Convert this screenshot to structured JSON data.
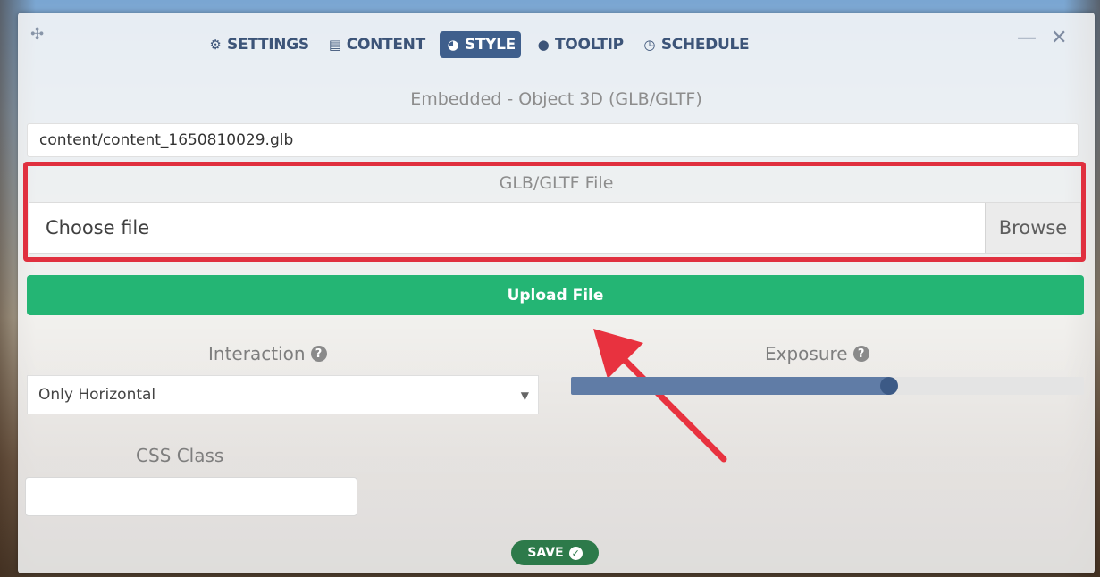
{
  "tabs": [
    {
      "label": "SETTINGS",
      "icon": "gear-icon",
      "glyph": "⚙",
      "active": false
    },
    {
      "label": "CONTENT",
      "icon": "content-icon",
      "glyph": "▤",
      "active": false
    },
    {
      "label": "STYLE",
      "icon": "palette-icon",
      "glyph": "◕",
      "active": true
    },
    {
      "label": "TOOLTIP",
      "icon": "chat-icon",
      "glyph": "●",
      "active": false
    },
    {
      "label": "SCHEDULE",
      "icon": "clock-icon",
      "glyph": "◷",
      "active": false
    }
  ],
  "window": {
    "minimize": "—",
    "close": "✕",
    "move": "✣"
  },
  "content": {
    "section_title": "Embedded - Object 3D (GLB/GLTF)",
    "file_path": "content/content_1650810029.glb",
    "file_label": "GLB/GLTF File",
    "file_placeholder": "Choose file",
    "browse_label": "Browse",
    "upload_label": "Upload File"
  },
  "interaction": {
    "label": "Interaction",
    "selected": "Only Horizontal"
  },
  "exposure": {
    "label": "Exposure",
    "value_fraction": 0.62
  },
  "css_class": {
    "label": "CSS Class",
    "value": ""
  },
  "save": {
    "label": "SAVE"
  },
  "colors": {
    "accent": "#3f5f8c",
    "upload": "#24b574",
    "highlight": "#e0303f",
    "save": "#2d7a4a"
  }
}
